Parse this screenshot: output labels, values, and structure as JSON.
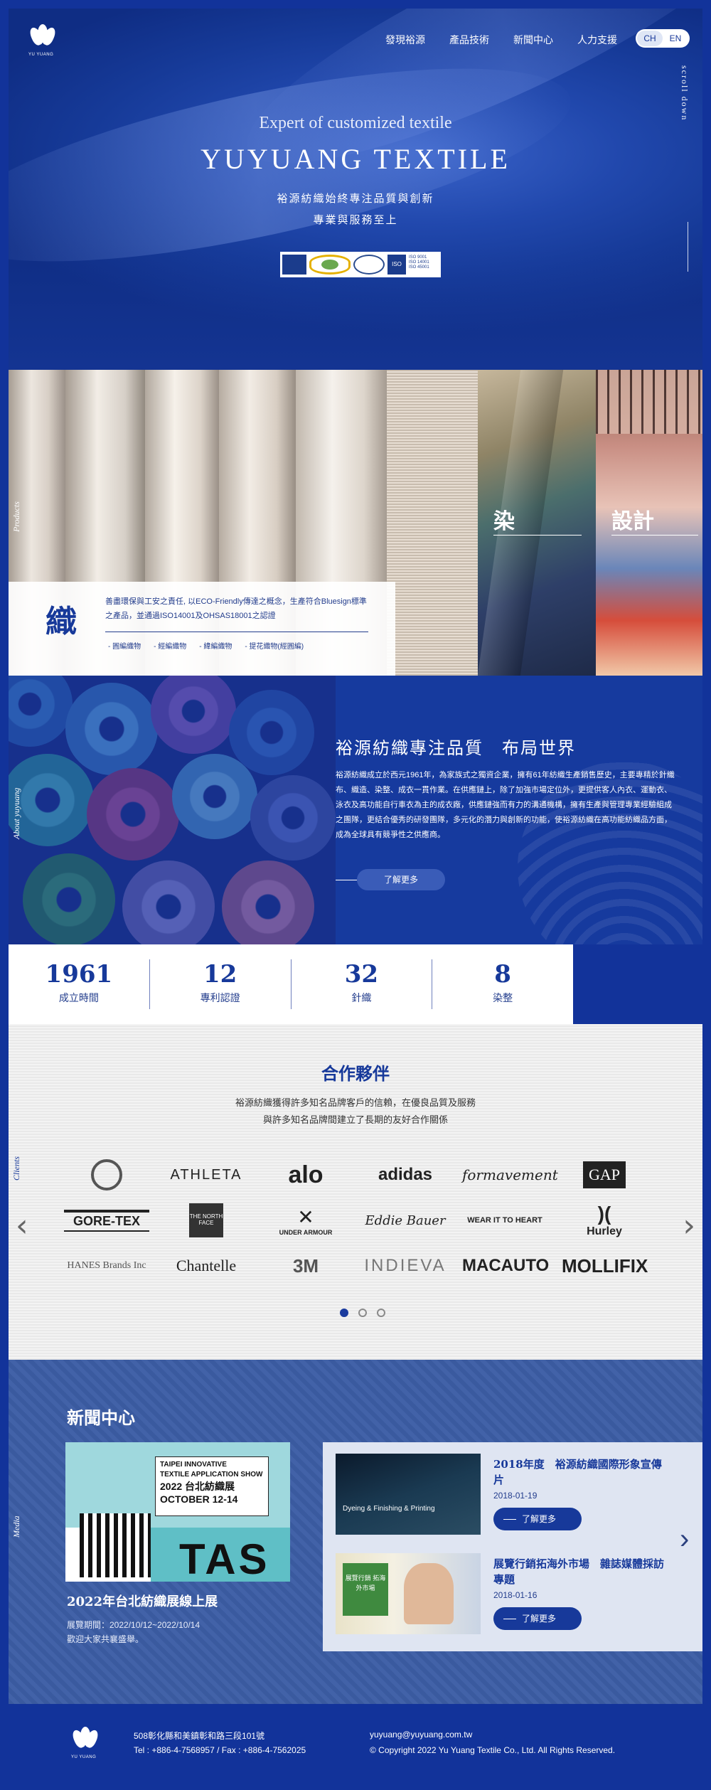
{
  "header": {
    "logo_caption": "YU YUANG",
    "nav": [
      "發現裕源",
      "產品技術",
      "新聞中心",
      "人力支援"
    ],
    "lang": [
      "CH",
      "EN"
    ]
  },
  "hero": {
    "subtitle": "Expert of customized textile",
    "title": "YUYUANG TEXTILE",
    "tagline1": "裕源紡織始終專注品質與創新",
    "tagline2": "專業與服務至上",
    "scroll_label": "scroll down"
  },
  "products": {
    "side_label": "Products",
    "heading": "織",
    "description": "善盡環保與工安之責任, 以ECO-Friendly傳達之概念，生產符合Bluesign標準之產品，並通過ISO14001及OHSAS18001之認證",
    "links": [
      "- 圓編織物",
      "- 經編織物",
      "- 緯編織物",
      "- 提花織物(經圓編)"
    ],
    "tile_dye": "染",
    "tile_design": "設計"
  },
  "about": {
    "side_label": "About yuyuang",
    "heading": "裕源紡織專注品質　布局世界",
    "body": "裕源紡織成立於西元1961年，為家族式之獨資企業，擁有61年紡織生產銷售歷史，主要專精於針織布、織造、染整、成衣一貫作業。在供應鏈上，除了加強市場定位外，更提供客人內衣、運動衣、泳衣及高功能自行車衣為主的成衣廠，供應鏈強而有力的溝通機構，擁有生產與管理專業經驗組成之團隊，更結合優秀的研發團隊，多元化的潛力與創新的功能，使裕源紡織在高功能紡織品方面，成為全球具有競爭性之供應商。",
    "more_label": "了解更多"
  },
  "stats": [
    {
      "value": "1961",
      "label": "成立時間"
    },
    {
      "value": "12",
      "label": "專利認證"
    },
    {
      "value": "32",
      "label": "針織"
    },
    {
      "value": "8",
      "label": "染整"
    }
  ],
  "clients": {
    "side_label": "Clients",
    "heading": "合作夥伴",
    "desc1": "裕源紡織獲得許多知名品牌客戶的信賴，在優良品質及服務",
    "desc2": "與許多知名品牌間建立了長期的友好合作關係",
    "prev": "‹",
    "next": "›",
    "rows": [
      [
        "lululemon",
        "ATHLETA",
        "alo",
        "adidas",
        "formavement",
        "GAP"
      ],
      [
        "GORE-TEX",
        "THE NORTH FACE",
        "UNDER ARMOUR",
        "Eddie Bauer",
        "WEAR IT TO HEART",
        "Hurley"
      ],
      [
        "HANES Brands Inc",
        "Chantelle",
        "3M",
        "INDIEVA",
        "MACAUTO",
        "MOLLIFIX"
      ]
    ]
  },
  "news": {
    "side_label": "Media",
    "heading": "新聞中心",
    "feature": {
      "poster_line1": "TAIPEI INNOVATIVE",
      "poster_line2": "TEXTILE APPLICATION SHOW",
      "poster_line3": "2022 台北紡織展",
      "poster_line4": "OCTOBER 12-14",
      "title": "2022年台北紡織展線上展",
      "dates": "展覽期間：2022/10/12~2022/10/14",
      "note": "歡迎大家共襄盛舉。"
    },
    "items": [
      {
        "title": "2018年度　裕源紡織國際形象宣傳片",
        "date": "2018-01-19",
        "btn": "了解更多",
        "thumb_caption": "Dyeing & Finishing & Printing"
      },
      {
        "title": "展覽行銷拓海外市場　雜誌媒體採訪專題",
        "date": "2018-01-16",
        "btn": "了解更多",
        "thumb_caption": "展覽行銷 拓海外市場"
      }
    ],
    "next": "›"
  },
  "footer": {
    "address": "508彰化縣和美鎮彰和路三段101號",
    "phone": "Tel : +886-4-7568957  /  Fax : +886-4-7562025",
    "email": "yuyuang@yuyuang.com.tw",
    "copyright": "© Copyright 2022 Yu Yuang Textile Co., Ltd. All Rights Reserved."
  }
}
